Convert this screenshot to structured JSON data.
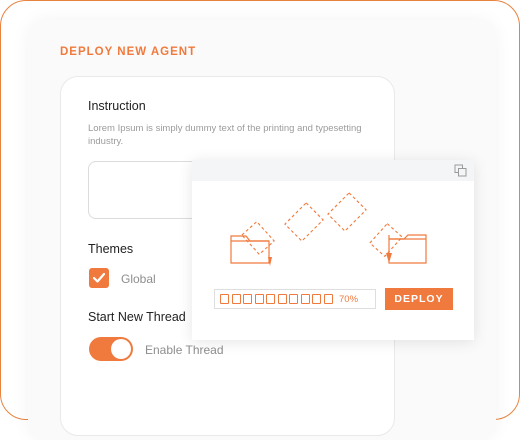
{
  "panel": {
    "title": "DEPLOY NEW AGENT"
  },
  "form": {
    "instruction": {
      "label": "Instruction",
      "help_text": "Lorem Ipsum is simply dummy text of the printing and typesetting industry.",
      "value": ""
    },
    "themes": {
      "label": "Themes",
      "checkbox_label": "Global",
      "checked": true
    },
    "thread": {
      "label": "Start New Thread",
      "toggle_label": "Enable Thread",
      "enabled": true
    }
  },
  "deploy_overlay": {
    "progress_percent_text": "70%",
    "progress_fraction": 0.7,
    "progress_cells": 10,
    "button_label": "DEPLOY",
    "header_icon": "copy-icon",
    "illustration_icons": [
      "folder-icon",
      "document-icon",
      "folder-icon"
    ]
  },
  "colors": {
    "accent": "#f07a3d",
    "border": "#e8833f",
    "muted_text": "#9b9b9b"
  }
}
